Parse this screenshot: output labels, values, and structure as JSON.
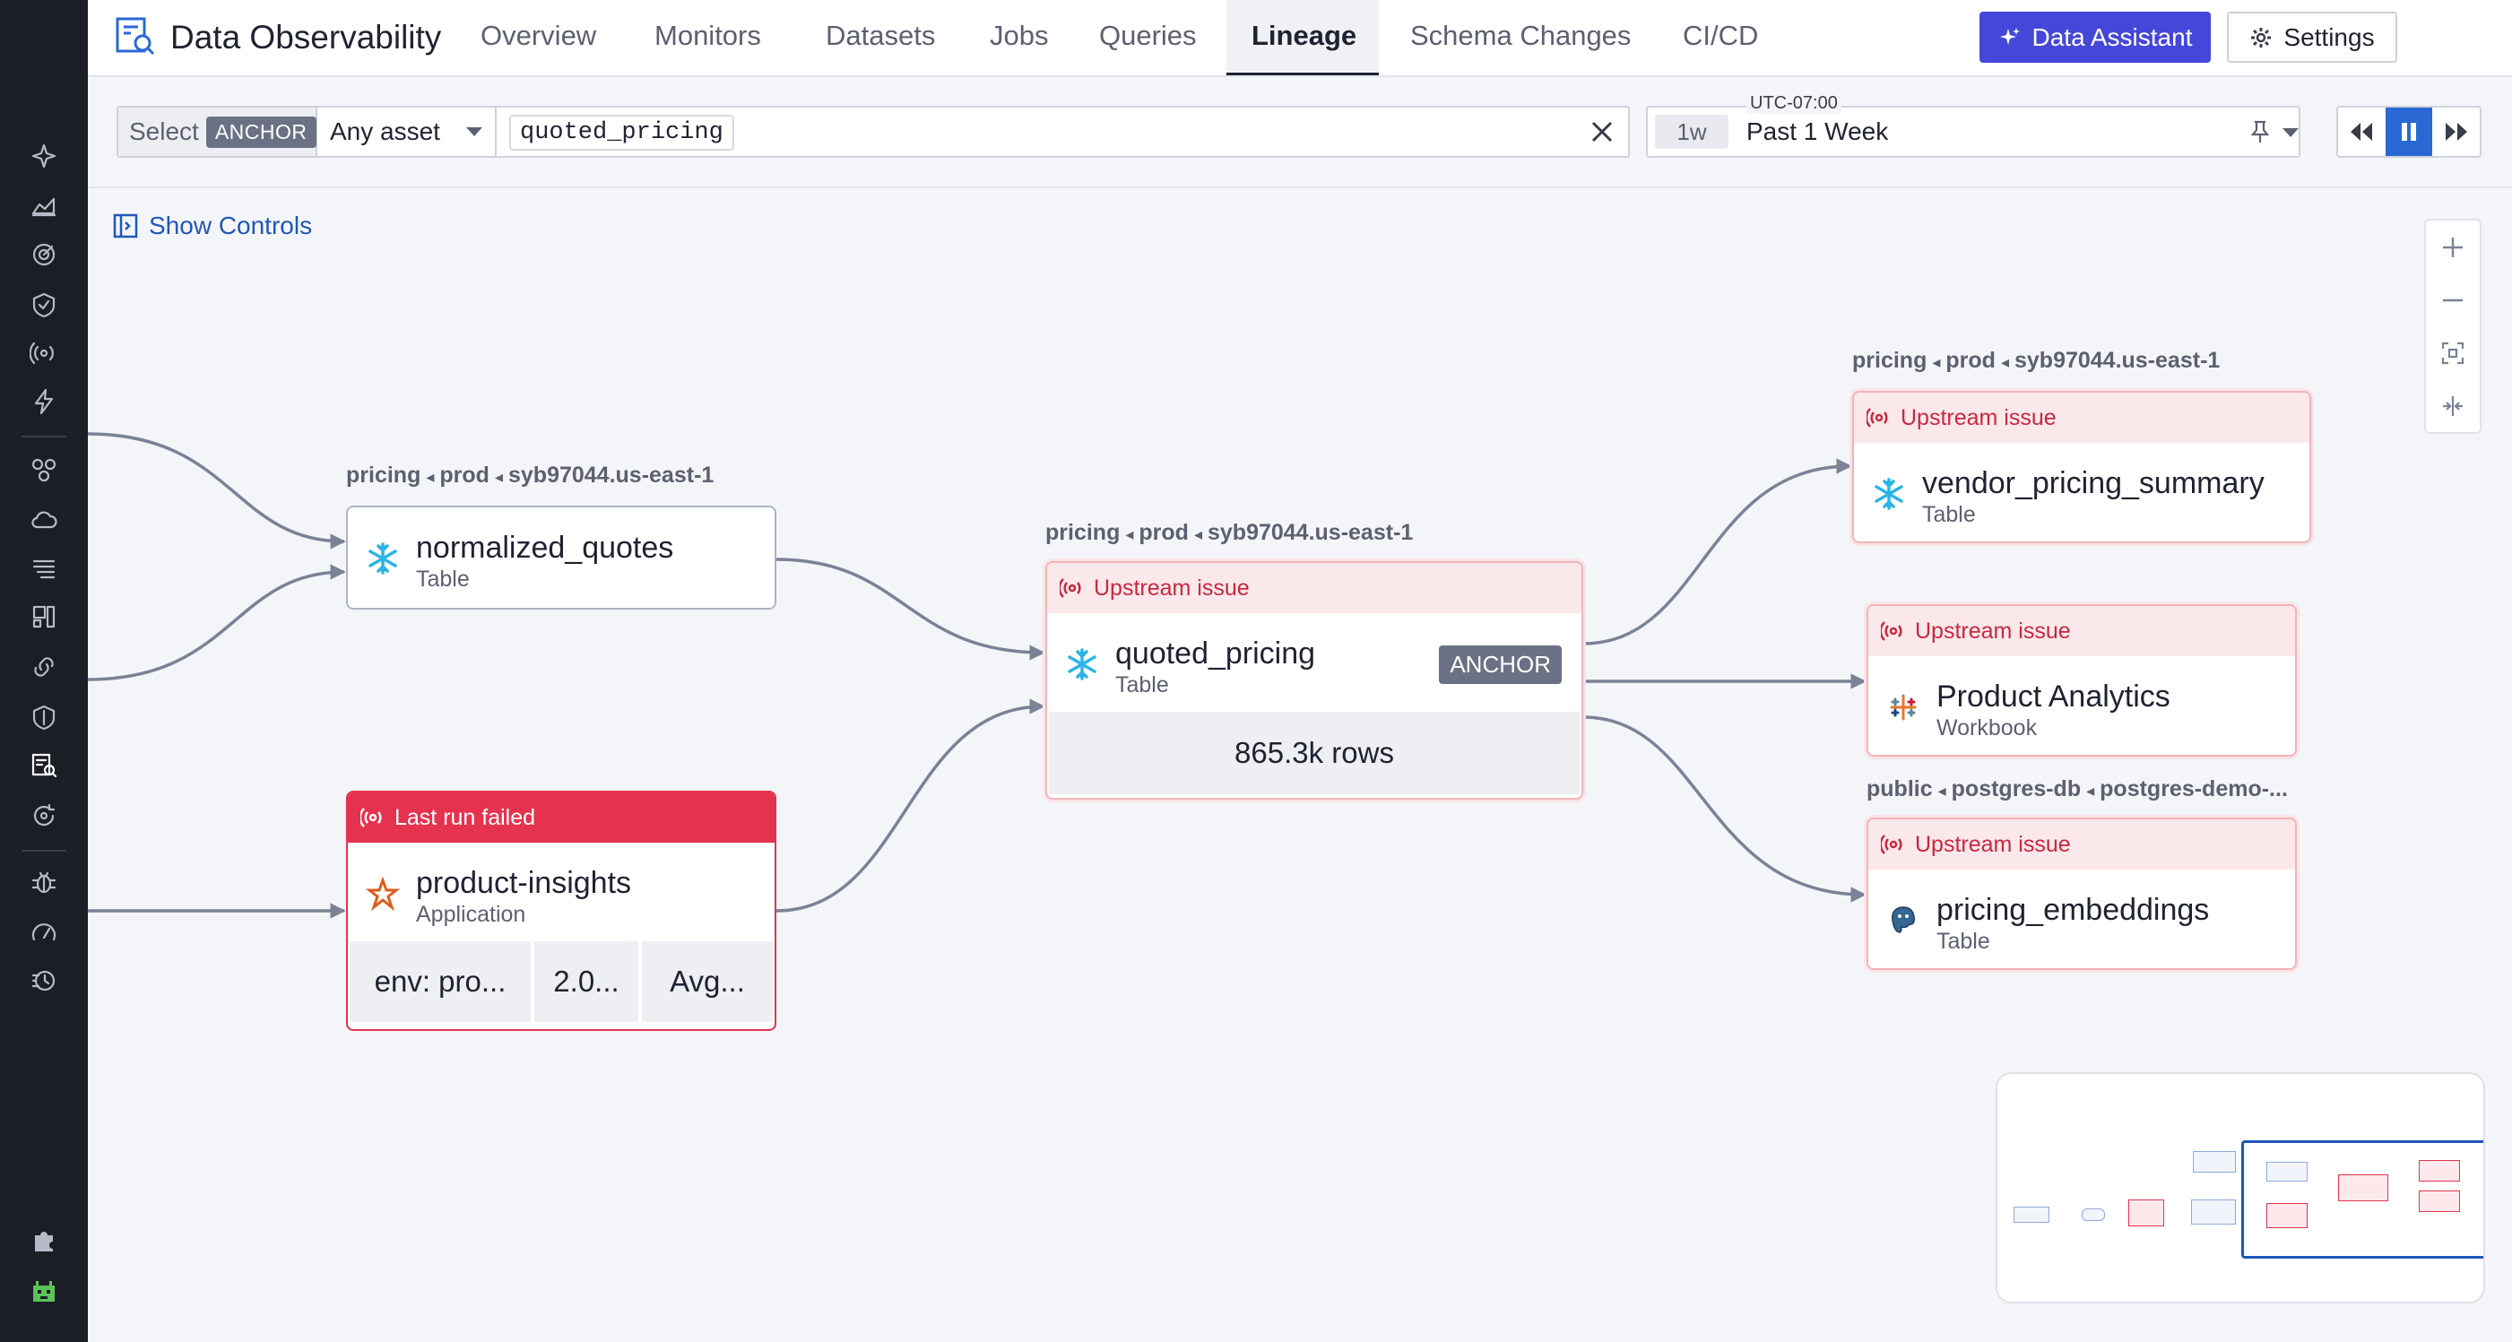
{
  "app": {
    "title": "Data Observability"
  },
  "tabs": [
    {
      "label": "Overview"
    },
    {
      "label": "Monitors"
    },
    {
      "label": "Datasets"
    },
    {
      "label": "Jobs"
    },
    {
      "label": "Queries"
    },
    {
      "label": "Lineage",
      "active": true
    },
    {
      "label": "Schema Changes"
    },
    {
      "label": "CI/CD"
    }
  ],
  "header": {
    "assistant_label": "Data Assistant",
    "settings_label": "Settings"
  },
  "filter": {
    "select_label": "Select",
    "anchor_chip": "ANCHOR",
    "asset_filter": "Any asset",
    "query": "quoted_pricing",
    "timezone": "UTC-07:00",
    "time_short": "1w",
    "time_range": "Past 1 Week"
  },
  "canvas": {
    "show_controls": "Show Controls"
  },
  "nodes": {
    "normalized_quotes": {
      "crumb": [
        "pricing",
        "prod",
        "syb97044.us-east-1"
      ],
      "name": "normalized_quotes",
      "type": "Table"
    },
    "quoted_pricing": {
      "crumb": [
        "pricing",
        "prod",
        "syb97044.us-east-1"
      ],
      "status": "Upstream issue",
      "name": "quoted_pricing",
      "type": "Table",
      "badge": "ANCHOR",
      "rows": "865.3k rows"
    },
    "product_insights": {
      "status": "Last run failed",
      "name": "product-insights",
      "type": "Application",
      "tags": [
        "env: pro...",
        "2.0...",
        "Avg..."
      ]
    },
    "vendor_pricing_summary": {
      "crumb": [
        "pricing",
        "prod",
        "syb97044.us-east-1"
      ],
      "status": "Upstream issue",
      "name": "vendor_pricing_summary",
      "type": "Table"
    },
    "product_analytics": {
      "status": "Upstream issue",
      "name": "Product Analytics",
      "type": "Workbook"
    },
    "pricing_embeddings": {
      "crumb": [
        "public",
        "postgres-db",
        "postgres-demo-..."
      ],
      "status": "Upstream issue",
      "name": "pricing_embeddings",
      "type": "Table"
    }
  },
  "icons": {
    "rail": [
      "sparkle-icon",
      "area-chart-icon",
      "radar-icon",
      "shield-icon",
      "signal-icon",
      "bolt-icon",
      "network-icon",
      "cloud-icon",
      "list-icon",
      "dashboard-icon",
      "link-icon",
      "security-icon",
      "data-observability-icon",
      "refresh-icon",
      "bug-icon",
      "speedometer-icon",
      "history-icon",
      "puzzle-icon",
      "user-avatar-icon"
    ]
  },
  "colors": {
    "accent": "#4547d9",
    "link": "#1f57b8",
    "issue": "#c8283f",
    "fail": "#e5334f",
    "rail": "#1c1e26"
  }
}
